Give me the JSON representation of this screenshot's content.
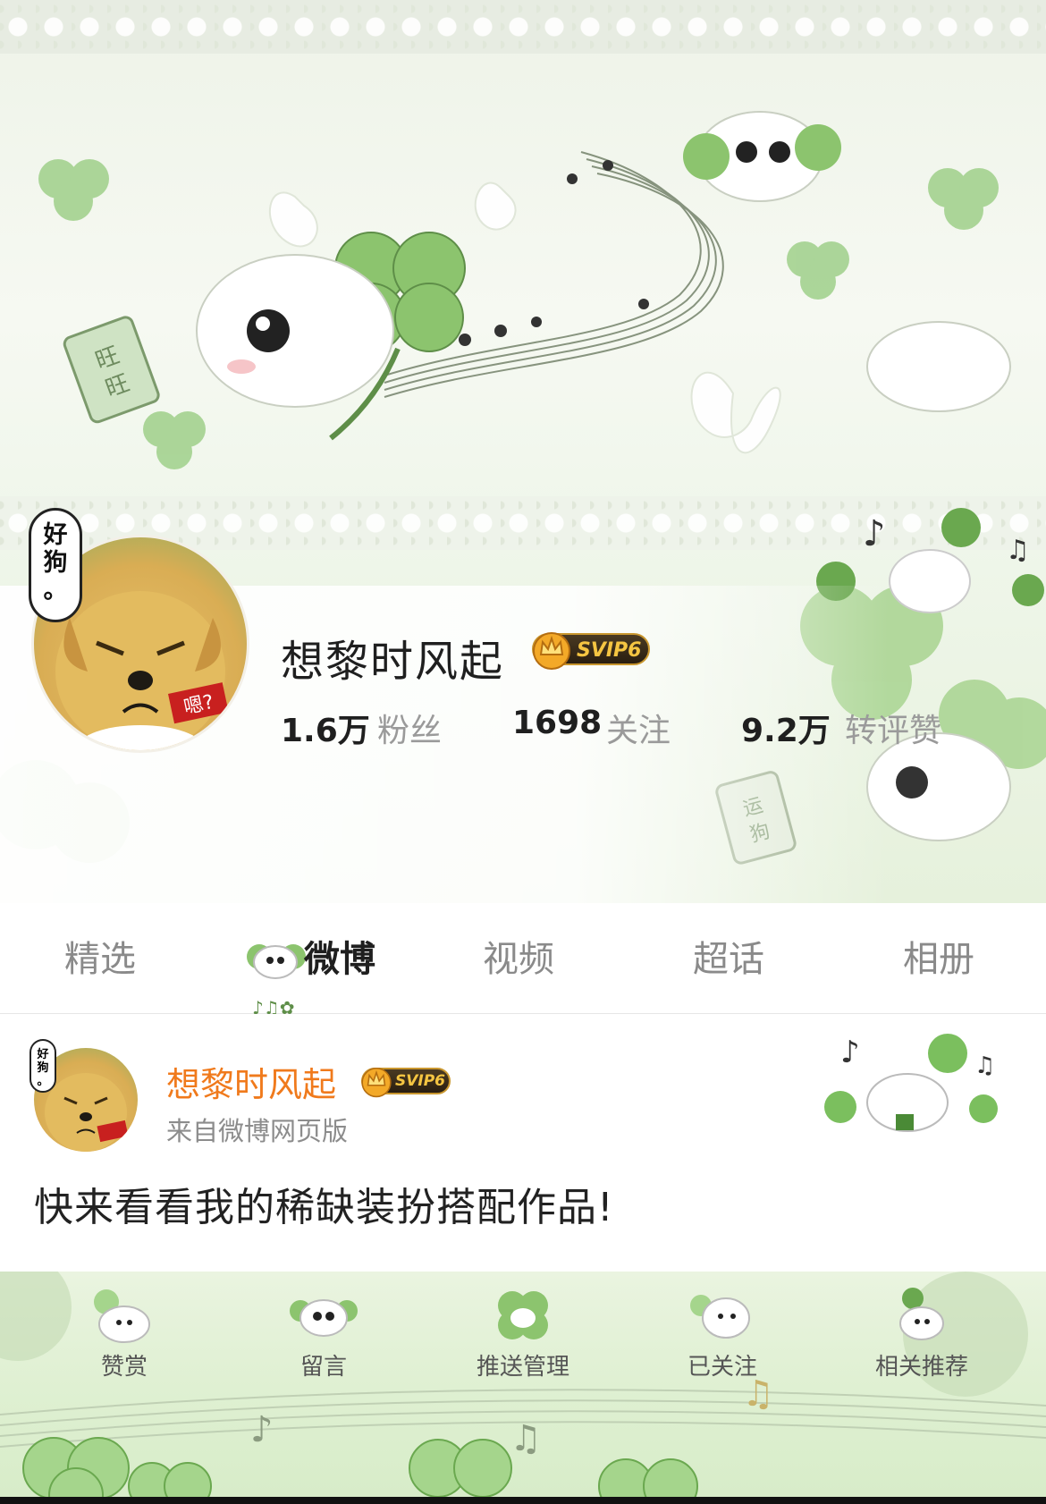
{
  "profile": {
    "avatar_bubble_text": "好狗。",
    "avatar_tag_text": "嗯?",
    "name": "想黎时风起",
    "vip_badge": "SVIP6",
    "stats": [
      {
        "value": "1.6万",
        "label": "粉丝"
      },
      {
        "value": "1698",
        "label": "关注"
      },
      {
        "value": "9.2万",
        "label": "转评赞"
      }
    ]
  },
  "tabs": [
    {
      "label": "精选",
      "active": false
    },
    {
      "label": "微博",
      "active": true
    },
    {
      "label": "视频",
      "active": false
    },
    {
      "label": "超话",
      "active": false
    },
    {
      "label": "相册",
      "active": false
    }
  ],
  "post": {
    "username": "想黎时风起",
    "vip_badge": "SVIP6",
    "source": "来自微博网页版",
    "text": "快来看看我的稀缺装扮搭配作品!"
  },
  "bottom_bar": [
    {
      "label": "赞赏",
      "icon": "dog-thumbs-up-icon"
    },
    {
      "label": "留言",
      "icon": "dog-message-icon"
    },
    {
      "label": "推送管理",
      "icon": "dog-clover-icon"
    },
    {
      "label": "已关注",
      "icon": "dog-followed-icon"
    },
    {
      "label": "相关推荐",
      "icon": "dog-recommend-icon"
    }
  ],
  "colors": {
    "accent_orange": "#f07a1c",
    "clover_green": "#8cc46e",
    "svip_gold": "#f5c542"
  }
}
